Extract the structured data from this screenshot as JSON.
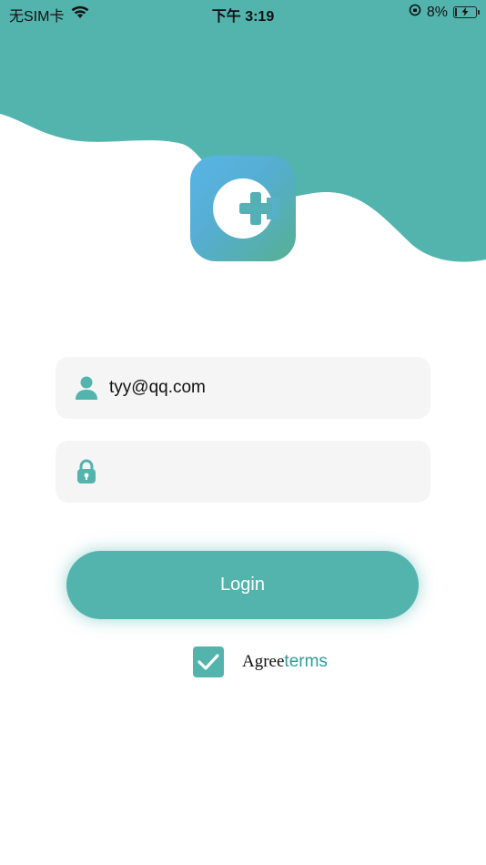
{
  "status_bar": {
    "carrier": "无SIM卡",
    "time": "下午 3:19",
    "battery_percent": "8%",
    "battery_level": 0.08,
    "wifi_icon": "wifi-icon",
    "lock_icon": "orientation-lock-icon",
    "battery_icon": "battery-charging-icon"
  },
  "colors": {
    "brand": "#53b4ae",
    "logo_gradient_start": "#5ab4e6",
    "logo_gradient_end": "#56b092",
    "field_bg": "#f5f5f5",
    "link": "#2f9d97"
  },
  "logo": {
    "icon": "medical-cross-logo-icon"
  },
  "form": {
    "email": {
      "icon": "user-icon",
      "value": "tyy@qq.com"
    },
    "password": {
      "icon": "lock-icon",
      "value": ""
    },
    "login_label": "Login",
    "agree": {
      "checked": true,
      "label": "Agree",
      "terms_label": "terms"
    }
  }
}
